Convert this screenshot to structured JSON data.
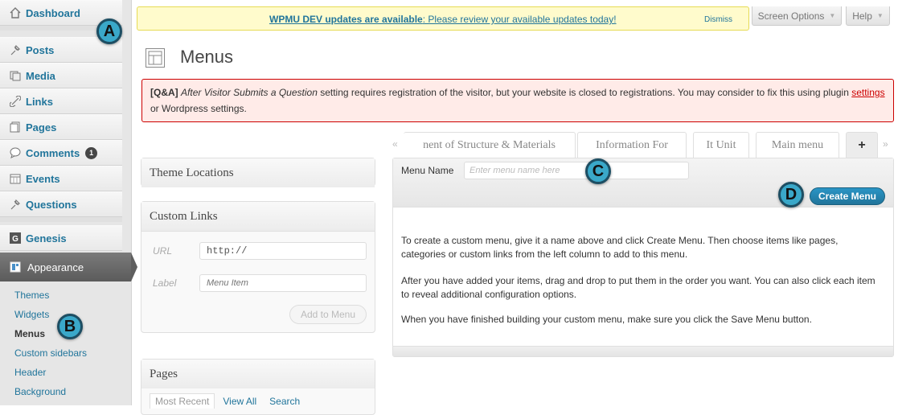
{
  "sidebar": {
    "items": [
      {
        "label": "Dashboard",
        "icon": "home-icon"
      },
      {
        "label": "Posts",
        "icon": "pin-icon"
      },
      {
        "label": "Media",
        "icon": "media-icon"
      },
      {
        "label": "Links",
        "icon": "link-icon"
      },
      {
        "label": "Pages",
        "icon": "page-icon"
      },
      {
        "label": "Comments",
        "icon": "comment-icon",
        "badge": "1"
      },
      {
        "label": "Events",
        "icon": "calendar-icon"
      },
      {
        "label": "Questions",
        "icon": "pin-icon"
      },
      {
        "label": "Genesis",
        "icon": "genesis-icon"
      }
    ],
    "appearance": {
      "label": "Appearance",
      "icon": "appearance-icon"
    },
    "submenu": [
      "Themes",
      "Widgets",
      "Menus",
      "Custom sidebars",
      "Header",
      "Background"
    ],
    "current_submenu": "Menus"
  },
  "markers": {
    "a": "A",
    "b": "B",
    "c": "C",
    "d": "D"
  },
  "notice": {
    "bold": "WPMU DEV updates are available",
    "rest": ": Please review your available updates today!",
    "dismiss": "Dismiss"
  },
  "header_tabs": {
    "screen_options": "Screen Options",
    "help": "Help"
  },
  "page_title": "Menus",
  "error": {
    "prefix": "[Q&A]",
    "italic": "After Visitor Submits a Question",
    "text1": " setting requires registration of the visitor, but your website is closed to registrations. You may consider to fix this using plugin ",
    "link": "settings",
    "text2": " or Wordpress settings."
  },
  "panels": {
    "theme_locations": "Theme Locations",
    "custom_links": {
      "title": "Custom Links",
      "url_label": "URL",
      "url_value": "http://",
      "label_label": "Label",
      "label_placeholder": "Menu Item",
      "add_button": "Add to Menu"
    },
    "pages": {
      "title": "Pages",
      "tabs": [
        "Most Recent",
        "View All",
        "Search"
      ]
    }
  },
  "menu_tabs": {
    "left_arrow": "«",
    "right_arrow": "»",
    "tabs": [
      "nent of Structure & Materials",
      "Information For",
      "It Unit",
      "Main menu"
    ],
    "add": "+"
  },
  "editor": {
    "menu_name_label": "Menu Name",
    "menu_name_placeholder": "Enter menu name here",
    "create_button": "Create Menu",
    "instructions": [
      "To create a custom menu, give it a name above and click Create Menu. Then choose items like pages, categories or custom links from the left column to add to this menu.",
      "After you have added your items, drag and drop to put them in the order you want. You can also click each item to reveal additional configuration options.",
      "When you have finished building your custom menu, make sure you click the Save Menu button."
    ]
  },
  "colors": {
    "link": "#21759b",
    "marker": "#3aa8c9",
    "error_border": "#cc0000",
    "notice_bg": "#fffbcc"
  }
}
